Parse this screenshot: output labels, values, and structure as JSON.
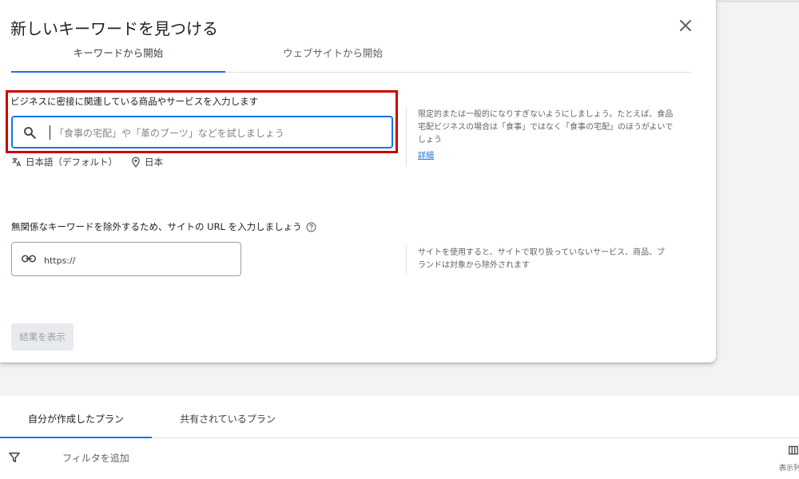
{
  "dialog": {
    "title": "新しいキーワードを見つける",
    "tabs": [
      {
        "label": "キーワードから開始",
        "active": true
      },
      {
        "label": "ウェブサイトから開始",
        "active": false
      }
    ],
    "keyword_section": {
      "label": "ビジネスに密接に関連している商品やサービスを入力します",
      "input_placeholder": "「食事の宅配」や「革のブーツ」などを試しましょう",
      "input_value": "",
      "language": "日本語（デフォルト）",
      "location": "日本",
      "help_text": "限定的または一般的になりすぎないようにしましょう。たとえば、食品宅配ビジネスの場合は「食事」ではなく「食事の宅配」のほうがよいでしょう",
      "help_link": "詳細"
    },
    "url_section": {
      "label": "無関係なキーワードを除外するため、サイトの URL を入力しましょう",
      "input_placeholder": "https://",
      "input_value": "",
      "help_text": "サイトを使用すると、サイトで取り扱っていないサービス、商品、ブランドは対象から除外されます"
    },
    "submit_label": "結果を表示"
  },
  "bottom": {
    "tabs": [
      {
        "label": "自分が作成したプラン",
        "active": true
      },
      {
        "label": "共有されているプラン",
        "active": false
      }
    ],
    "filter_label": "フィルタを追加",
    "columns_label": "表示列"
  },
  "colors": {
    "accent": "#1a73e8",
    "highlight_box": "#cc0000",
    "disabled_button_bg": "#e8eaed"
  },
  "icons": {
    "close": "close-icon",
    "search": "search-icon",
    "translate": "translate-icon",
    "location": "location-pin-icon",
    "help": "help-circle-icon",
    "link": "link-icon",
    "filter": "filter-icon",
    "columns": "columns-icon"
  }
}
